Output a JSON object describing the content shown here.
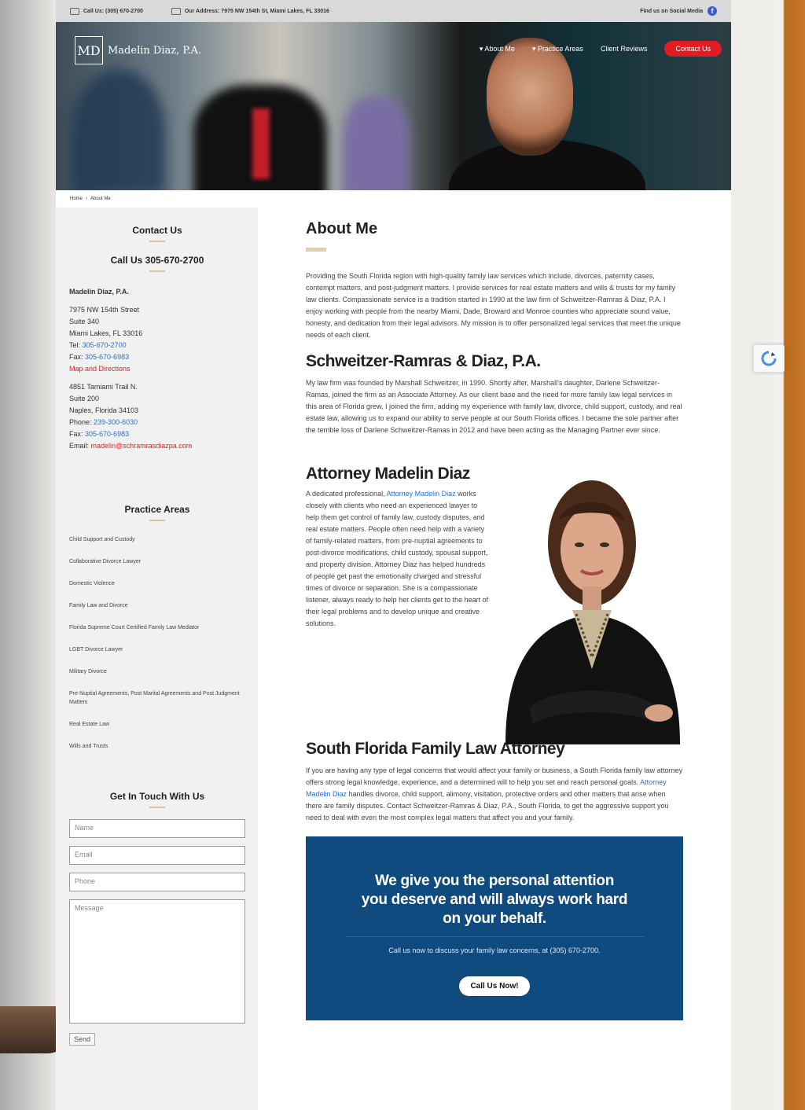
{
  "topbar": {
    "phone": "Call Us: (305) 670-2700",
    "address": "Our Address: 7975 NW 154th St, Miami Lakes, FL 33016",
    "social": "Find us on Social Media"
  },
  "header": {
    "logo_mark": "MD",
    "logo_name": "Madelin Diaz, P.A.",
    "nav": [
      "About Me",
      "Practice Areas",
      "Client Reviews"
    ],
    "nav_cta": "Contact Us"
  },
  "breadcrumb": [
    "Home",
    "›",
    "About Me"
  ],
  "sidebar": {
    "contact_heading": "Contact Us",
    "call_heading": "Call Us 305-670-2700",
    "firm": "Madelin Diaz, P.A.",
    "office1": {
      "street": "7975 NW 154th Street",
      "suite": "Suite 340",
      "city": "Miami Lakes, FL 33016",
      "tel_label": "Tel:",
      "tel": "305-670-2700",
      "fax_label": "Fax:",
      "fax": "305-670-6983",
      "map_link": "Map and Directions"
    },
    "office2": {
      "street": "4851 Tamiami Trail N.",
      "suite": "Suite 200",
      "city": "Naples, Florida 34103",
      "phone_label": "Phone:",
      "phone": "239-300-6030",
      "fax_label": "Fax:",
      "fax": "305-670-6983",
      "email_label": "Email:",
      "email": "madelin@schramrasdiazpa.com"
    },
    "practice_heading": "Practice Areas",
    "practice_areas": [
      "Child Support and Custody",
      "Collaborative Divorce Lawyer",
      "Domestic Violence",
      "Family Law and Divorce",
      "Florida Supreme Court Certified Family Law Mediator",
      "LGBT Divorce Lawyer",
      "Military Divorce",
      "Pre-Nuptial Agreements, Post Marital Agreements and Post Judgment Matters",
      "Real Estate Law",
      "Wills and Trusts"
    ],
    "form_heading": "Get In Touch With Us",
    "form": {
      "name_placeholder": "Name",
      "email_placeholder": "Email",
      "phone_placeholder": "Phone",
      "message_placeholder": "Message",
      "send_label": "Send"
    }
  },
  "main": {
    "about_title": "About Me",
    "about_text": "Providing the South Florida region with high-quality family law services which include, divorces, paternity cases, contempt matters, and post-judgment matters. I provide services for real estate matters and wills & trusts for my family law clients. Compassionate service is a tradition started in 1990 at the law firm of Schweitzer-Ramras & Diaz, P.A. I enjoy working with people from the nearby Miami, Dade, Broward and Monroe counties who appreciate sound value, honesty, and dedication from their legal advisors. My mission is to offer personalized legal services that meet the unique needs of each client.",
    "firm_title": "Schweitzer-Ramras & Diaz, P.A.",
    "firm_text": "My law firm was founded by Marshall Schweitzer, in 1990. Shortly after, Marshall's daughter, Darlene Schweitzer-Ramas, joined the firm as an Associate Attorney. As our client base and the need for more family law legal services in this area of Florida grew, I joined the firm, adding my experience with family law, divorce, child support, custody, and real estate law, allowing us to expand our ability to serve people at our South Florida offices. I became the sole partner after the terrible loss of Darlene Schweitzer-Ramas in 2012 and have been acting as the Managing Partner ever since.",
    "attorney_title": "Attorney Madelin Diaz",
    "attorney_text_pre": "A dedicated professional, ",
    "attorney_link": "Attorney Madelin Diaz",
    "attorney_text_post": " works closely with clients who need an experienced lawyer to help them get control of family law, custody disputes, and real estate matters. People often need help with a variety of family-related matters, from pre-nuptial agreements to post-divorce modifications, child custody, spousal support, and property division. Attorney Diaz has helped hundreds of people get past the emotionally charged and stressful times of divorce or separation. She is a compassionate listener, always ready to help her clients get to the heart of their legal problems and to develop unique and creative solutions.",
    "sf_title": "South Florida Family Law Attorney",
    "sf_text_pre": "If you are having any type of legal concerns that would affect your family or business, a South Florida family law attorney offers strong legal knowledge, experience, and a determined will to help you set and reach personal goals. ",
    "sf_link": "Attorney Madelin Diaz",
    "sf_text_post": " handles divorce, child support, alimony, visitation, protective orders and other matters that arise when there are family disputes. Contact Schweitzer-Ramras & Diaz, P.A., South Florida, to get the aggressive support you need to deal with even the most complex legal matters that affect you and your family.",
    "cta": {
      "heading_l1": "We give you the personal attention",
      "heading_l2": "you deserve and will always work hard",
      "heading_l3": "on your behalf.",
      "text": "Call us now to discuss your family law concerns, at (305) 670-2700.",
      "button": "Call Us Now!"
    }
  },
  "colors": {
    "accent_red": "#e31b23",
    "cta_blue": "#104b7f",
    "link_blue": "#2c6fcf",
    "gold_rule": "#ddd0a8"
  }
}
